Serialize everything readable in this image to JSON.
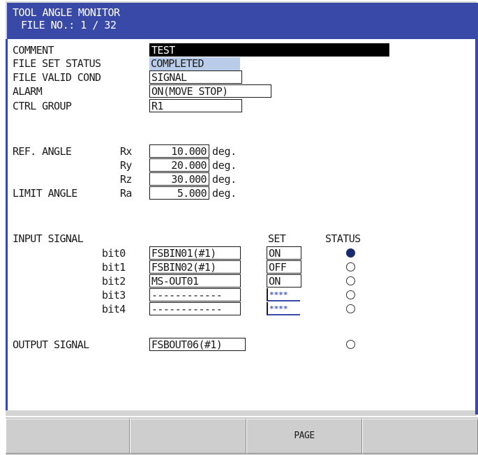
{
  "header": {
    "title": "TOOL ANGLE MONITOR",
    "file_no": "FILE NO.:  1 / 32"
  },
  "settings": {
    "comment": {
      "label": "COMMENT",
      "value": "TEST"
    },
    "file_set_status": {
      "label": "FILE SET STATUS",
      "value": "COMPLETED"
    },
    "file_valid_cond": {
      "label": "FILE VALID COND",
      "value": "SIGNAL"
    },
    "alarm": {
      "label": "ALARM",
      "value": "ON(MOVE STOP)"
    },
    "ctrl_group": {
      "label": "CTRL GROUP",
      "value": "R1"
    }
  },
  "angles": {
    "ref_label": "REF. ANGLE",
    "limit_label": "LIMIT ANGLE",
    "unit": "deg.",
    "rx": {
      "axis": "Rx",
      "value": "10.000"
    },
    "ry": {
      "axis": "Ry",
      "value": "20.000"
    },
    "rz": {
      "axis": "Rz",
      "value": "30.000"
    },
    "ra": {
      "axis": "Ra",
      "value": "5.000"
    }
  },
  "input_signal": {
    "label": "INPUT SIGNAL",
    "set_header": "SET",
    "status_header": "STATUS",
    "bits": [
      {
        "bit": "bit0",
        "signal": "FSBIN01(#1)",
        "set": "ON",
        "status": "on"
      },
      {
        "bit": "bit1",
        "signal": "FSBIN02(#1)",
        "set": "OFF",
        "status": "off"
      },
      {
        "bit": "bit2",
        "signal": "MS-OUT01",
        "set": "ON",
        "status": "off"
      },
      {
        "bit": "bit3",
        "signal": "------------",
        "set": "****",
        "status": "off"
      },
      {
        "bit": "bit4",
        "signal": "------------",
        "set": "****",
        "status": "off"
      }
    ]
  },
  "output_signal": {
    "label": "OUTPUT SIGNAL",
    "signal": "FSBOUT06(#1)",
    "status": "off"
  },
  "footer": {
    "buttons": [
      "",
      "",
      "PAGE",
      "",
      ""
    ]
  }
}
